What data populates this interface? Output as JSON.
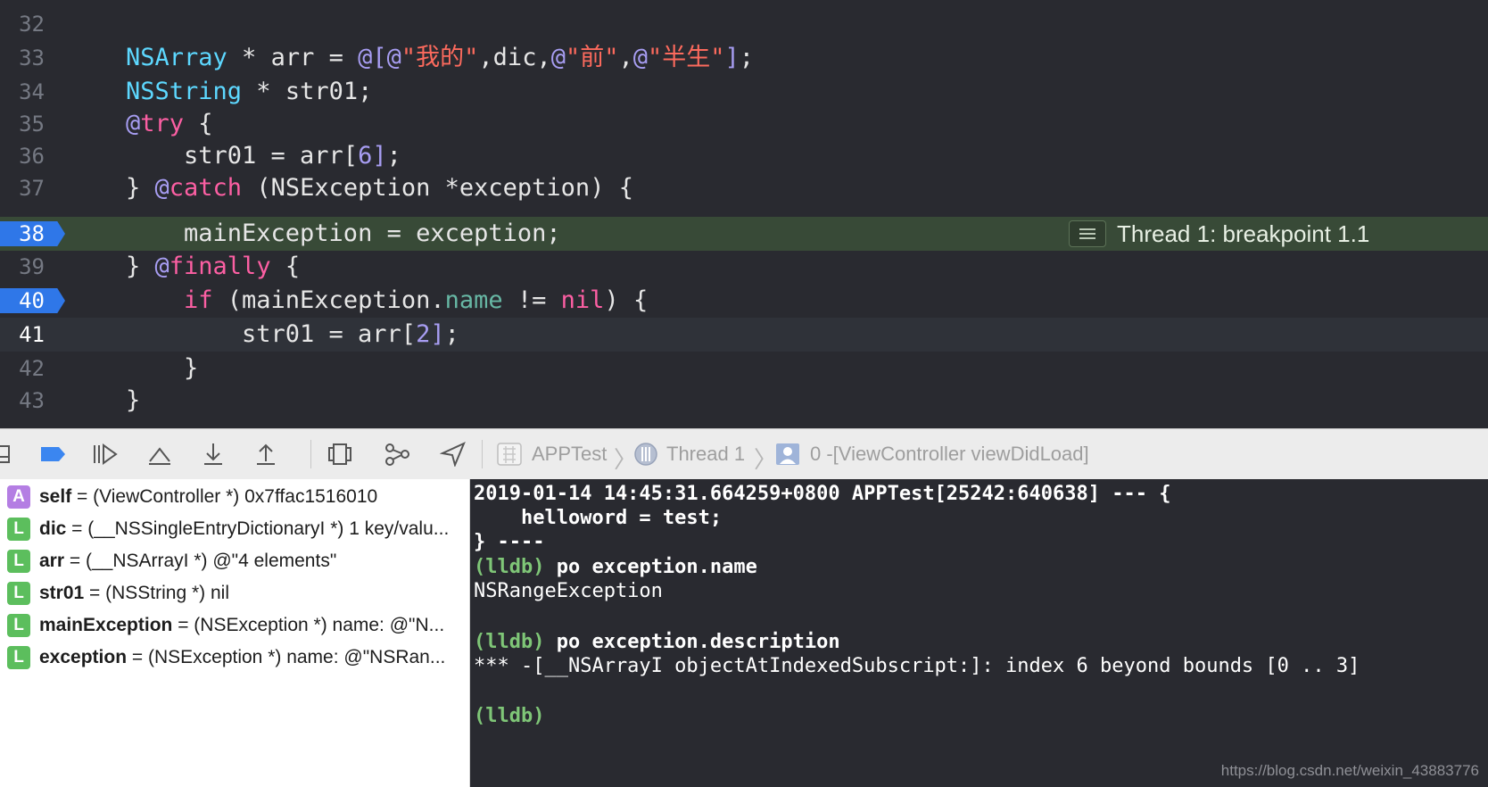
{
  "editor": {
    "lines": [
      {
        "num": "32",
        "text": ""
      },
      {
        "num": "33",
        "text": "NSArray * arr = @[@\"我的\",dic,@\"前\",@\"半生\"];"
      },
      {
        "num": "34",
        "text": "NSString * str01;"
      },
      {
        "num": "35",
        "text": "@try {"
      },
      {
        "num": "36",
        "text": "str01 = arr[6];"
      },
      {
        "num": "37",
        "text": "} @catch (NSException *exception) {"
      },
      {
        "num": "38",
        "text": "mainException = exception;"
      },
      {
        "num": "39",
        "text": "} @finally {"
      },
      {
        "num": "40",
        "text": "if (mainException.name != nil) {"
      },
      {
        "num": "41",
        "text": "str01 = arr[2];"
      },
      {
        "num": "42",
        "text": "}"
      },
      {
        "num": "43",
        "text": "}"
      }
    ],
    "breakpoint_badge": "Thread 1: breakpoint 1.1"
  },
  "debug_bar": {
    "buttons": [
      "hide-debug-area",
      "breakpoints-toggle",
      "continue",
      "step-over",
      "step-into",
      "step-out",
      "view-hierarchy",
      "memory-graph",
      "simulate-location"
    ],
    "breadcrumb": [
      "APPTest",
      "Thread 1",
      "0 -[ViewController viewDidLoad]"
    ]
  },
  "variables": [
    {
      "kind": "A",
      "name": "self",
      "value": " = (ViewController *) 0x7ffac1516010"
    },
    {
      "kind": "L",
      "name": "dic",
      "value": " = (__NSSingleEntryDictionaryI *) 1 key/valu..."
    },
    {
      "kind": "L",
      "name": "arr",
      "value": " = (__NSArrayI *) @\"4 elements\""
    },
    {
      "kind": "L",
      "name": "str01",
      "value": " = (NSString *) nil"
    },
    {
      "kind": "L",
      "name": "mainException",
      "value": " = (NSException *) name: @\"N..."
    },
    {
      "kind": "L",
      "name": "exception",
      "value": " = (NSException *) name: @\"NSRan..."
    }
  ],
  "console": {
    "l1": "2019-01-14 14:45:31.664259+0800 APPTest[25242:640638] --- {",
    "l2": "    helloword = test;",
    "l3": "} ----",
    "prompt": "(lldb)",
    "cmd1": " po exception.name",
    "out1": "NSRangeException",
    "cmd2": " po exception.description",
    "out2": "*** -[__NSArrayI objectAtIndexedSubscript:]: index 6 beyond bounds [0 .. 3]"
  },
  "watermark": "https://blog.csdn.net/weixin_43883776",
  "colors": {
    "editor_bg": "#292a30",
    "breakpoint_blue": "#2f77e8",
    "current_line": "#384a37",
    "prompt_green": "#7fc677"
  }
}
